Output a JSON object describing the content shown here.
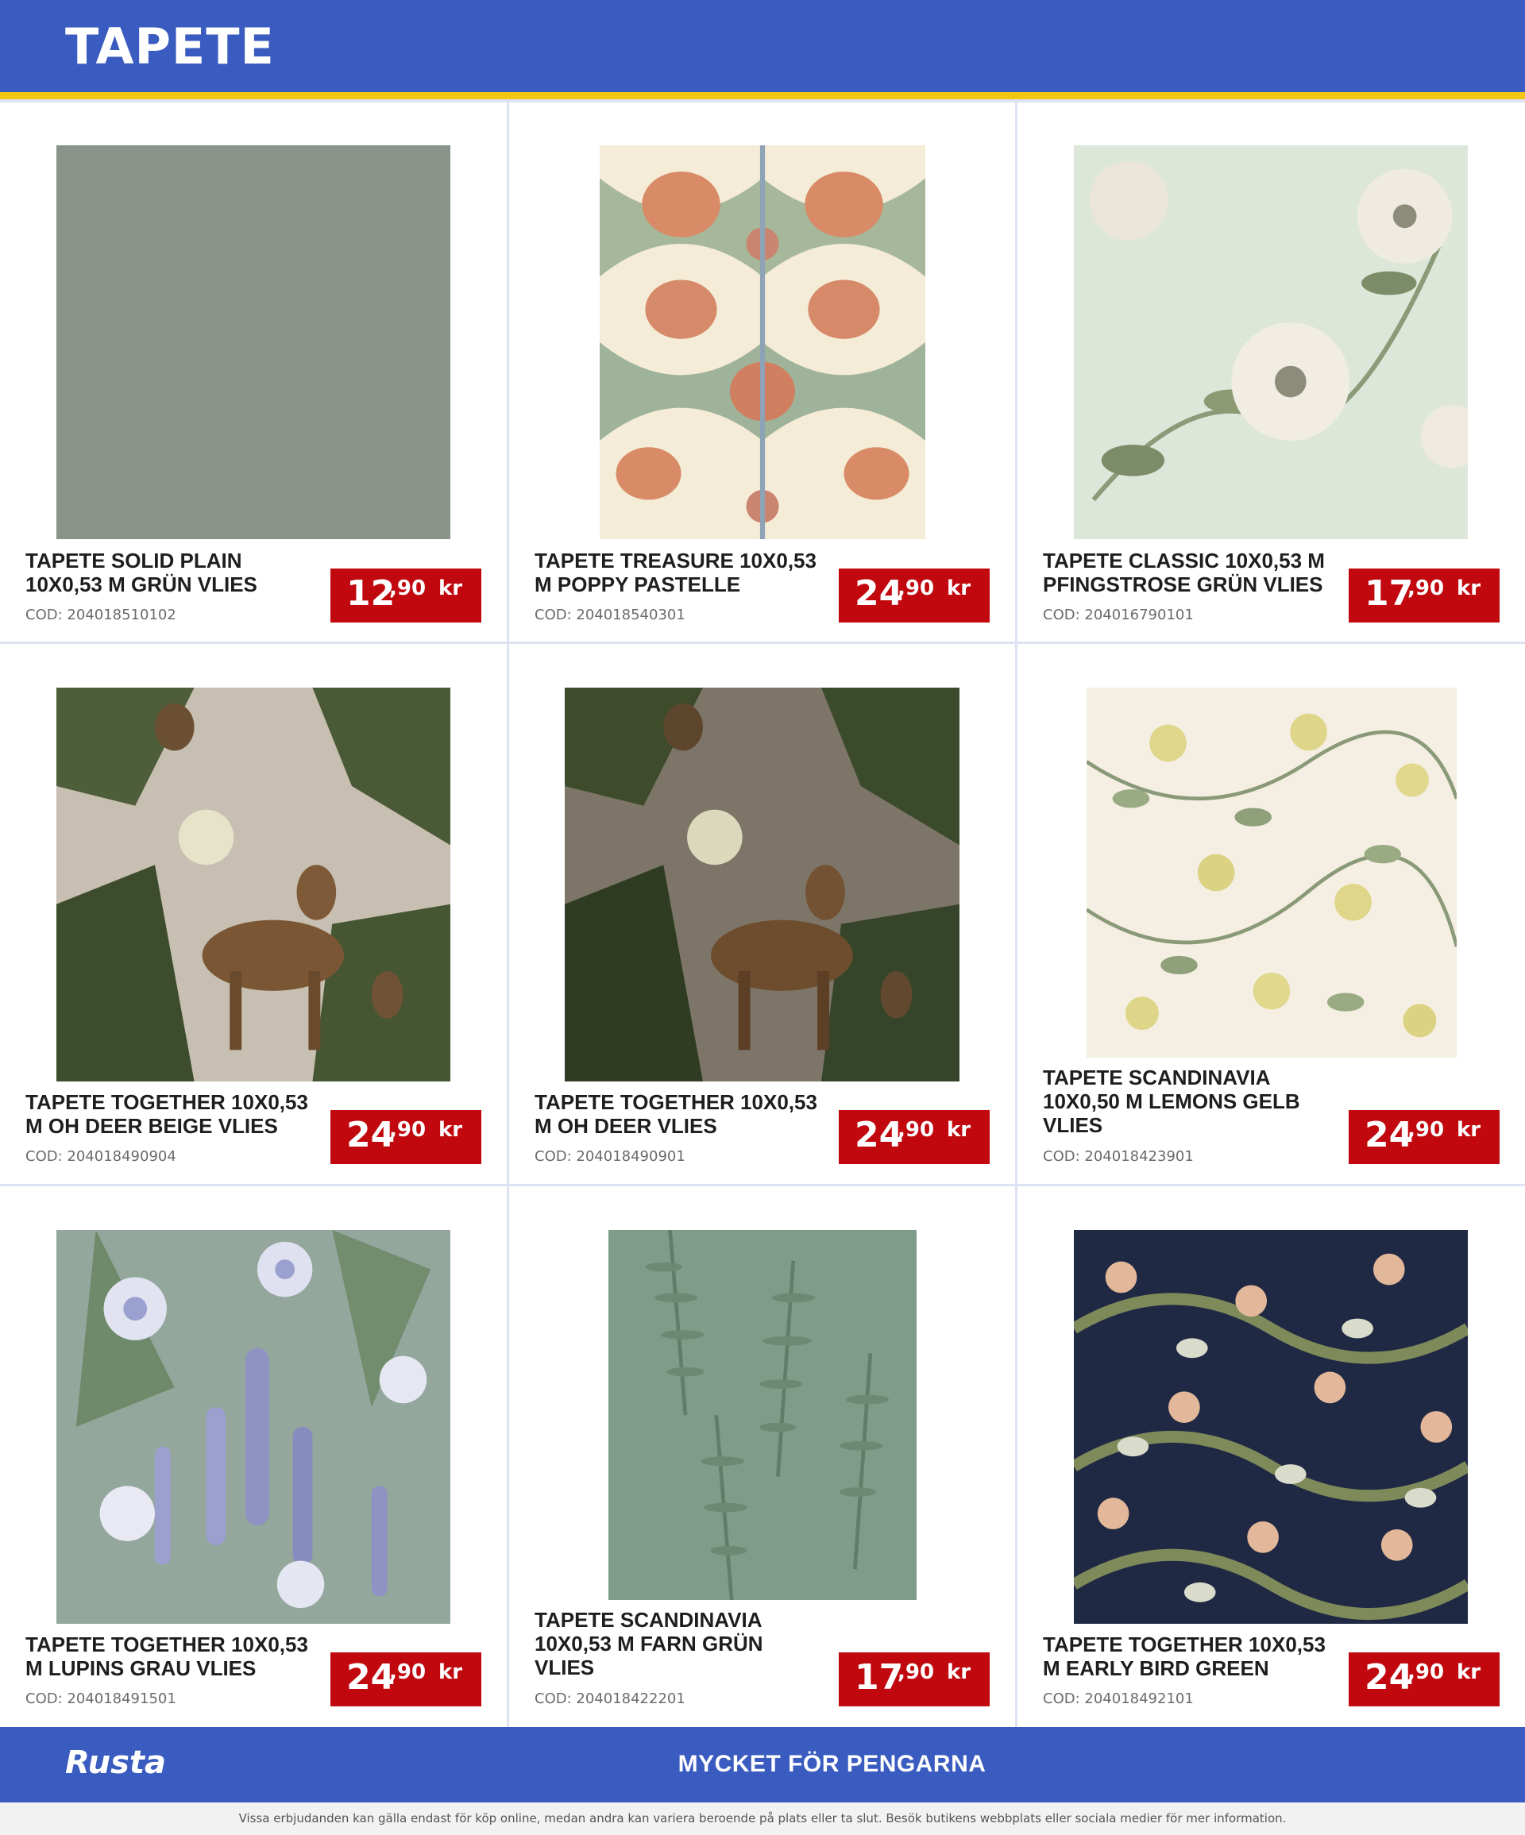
{
  "header": {
    "title": "TAPETE"
  },
  "products": [
    {
      "name_line1": "TAPETE SOLID PLAIN",
      "name_line2": "10X0,53 M GRÜN VLIES",
      "name_line3": "",
      "code": "COD: 204018510102",
      "price_int": "12",
      "price_dec": ",90",
      "currency": "kr",
      "image": "solid-green-wallpaper"
    },
    {
      "name_line1": "TAPETE TREASURE 10X0,53",
      "name_line2": "M POPPY PASTELLE",
      "name_line3": "",
      "code": "COD: 204018540301",
      "price_int": "24",
      "price_dec": ",90",
      "currency": "kr",
      "image": "poppy-pastel-wallpaper"
    },
    {
      "name_line1": "TAPETE CLASSIC 10X0,53 M",
      "name_line2": "PFINGSTROSE GRÜN VLIES",
      "name_line3": "",
      "code": "COD: 204016790101",
      "price_int": "17",
      "price_dec": ",90",
      "currency": "kr",
      "image": "peony-wallpaper"
    },
    {
      "name_line1": "TAPETE TOGETHER 10X0,53",
      "name_line2": "M OH DEER BEIGE VLIES",
      "name_line3": "",
      "code": "COD: 204018490904",
      "price_int": "24",
      "price_dec": ",90",
      "currency": "kr",
      "image": "deer-beige-wallpaper"
    },
    {
      "name_line1": "TAPETE TOGETHER 10X0,53",
      "name_line2": "M OH DEER VLIES",
      "name_line3": "",
      "code": "COD: 204018490901",
      "price_int": "24",
      "price_dec": ",90",
      "currency": "kr",
      "image": "deer-dark-wallpaper"
    },
    {
      "name_line1": "TAPETE SCANDINAVIA",
      "name_line2": "10X0,50 M LEMONS GELB",
      "name_line3": "VLIES",
      "code": "COD: 204018423901",
      "price_int": "24",
      "price_dec": ",90",
      "currency": "kr",
      "image": "lemons-wallpaper"
    },
    {
      "name_line1": "TAPETE TOGETHER 10X0,53",
      "name_line2": "M LUPINS GRAU VLIES",
      "name_line3": "",
      "code": "COD: 204018491501",
      "price_int": "24",
      "price_dec": ",90",
      "currency": "kr",
      "image": "lupins-wallpaper"
    },
    {
      "name_line1": "TAPETE SCANDINAVIA",
      "name_line2": "10X0,53 M FARN GRÜN",
      "name_line3": "VLIES",
      "code": "COD: 204018422201",
      "price_int": "17",
      "price_dec": ",90",
      "currency": "kr",
      "image": "fern-wallpaper"
    },
    {
      "name_line1": "TAPETE TOGETHER 10X0,53",
      "name_line2": "M EARLY BIRD GREEN",
      "name_line3": "",
      "code": "COD: 204018492101",
      "price_int": "24",
      "price_dec": ",90",
      "currency": "kr",
      "image": "early-bird-wallpaper"
    }
  ],
  "footer": {
    "brand": "Rusta",
    "slogan": "MYCKET FÖR PENGARNA",
    "disclaimer": "Vissa erbjudanden kan gälla endast för köp online, medan andra kan variera beroende på plats eller ta slut. Besök butikens webbplats eller sociala medier för mer information."
  },
  "colors": {
    "header": "#3a5bbf",
    "stripe": "#f3c614",
    "price_badge": "#c0080e",
    "grid_line": "#dde3f2"
  }
}
